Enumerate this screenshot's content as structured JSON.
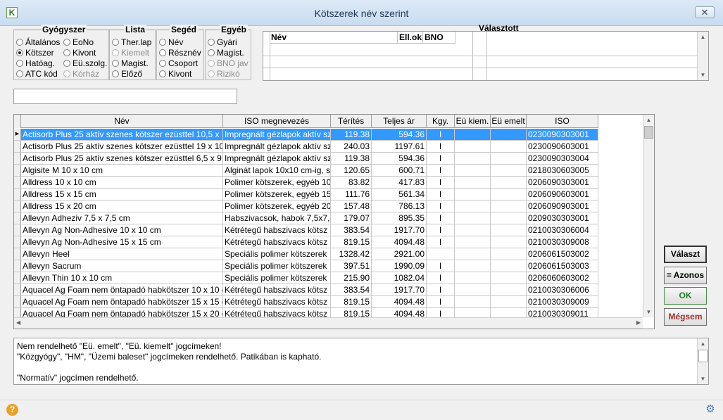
{
  "window": {
    "title": "Kötszerek név szerint",
    "close_label": "✕",
    "app_icon": "K"
  },
  "groups": {
    "gyogyszer": {
      "title": "Gyógyszer",
      "options": [
        {
          "label": "Általános",
          "checked": false,
          "disabled": false
        },
        {
          "label": "EoNo",
          "checked": false,
          "disabled": false
        },
        {
          "label": "Kötszer",
          "checked": true,
          "disabled": false
        },
        {
          "label": "Kivont",
          "checked": false,
          "disabled": false
        },
        {
          "label": "Hatóag.",
          "checked": false,
          "disabled": false
        },
        {
          "label": "Eü.szolg.",
          "checked": false,
          "disabled": false
        },
        {
          "label": "ATC kód",
          "checked": false,
          "disabled": false
        },
        {
          "label": "Kórház",
          "checked": false,
          "disabled": true
        }
      ]
    },
    "lista": {
      "title": "Lista",
      "options": [
        {
          "label": "Ther.lap",
          "checked": false,
          "disabled": false
        },
        {
          "label": "Kiemelt",
          "checked": false,
          "disabled": true
        },
        {
          "label": "Magist.",
          "checked": false,
          "disabled": false
        },
        {
          "label": "Előző",
          "checked": false,
          "disabled": false
        }
      ]
    },
    "seged": {
      "title": "Segéd",
      "options": [
        {
          "label": "Név",
          "checked": false,
          "disabled": false
        },
        {
          "label": "Résznév",
          "checked": false,
          "disabled": false
        },
        {
          "label": "Csoport",
          "checked": false,
          "disabled": false
        },
        {
          "label": "Kivont",
          "checked": false,
          "disabled": false
        }
      ]
    },
    "egyeb": {
      "title": "Egyéb",
      "options": [
        {
          "label": "Gyári",
          "checked": false,
          "disabled": false
        },
        {
          "label": "Magist.",
          "checked": false,
          "disabled": false
        },
        {
          "label": "BNO jav",
          "checked": false,
          "disabled": true
        },
        {
          "label": "Rizikó",
          "checked": false,
          "disabled": true
        }
      ]
    }
  },
  "selected": {
    "title": "Választott",
    "headers": [
      "Név",
      "Ell.ok",
      "BNO"
    ]
  },
  "search": {
    "value": ""
  },
  "grid": {
    "headers": [
      "Név",
      "ISO megnevezés",
      "Térítés",
      "Teljes ár",
      "Kgy.",
      "Eü kiem.",
      "Eü emelt",
      "ISO"
    ],
    "rows": [
      [
        "Actisorb Plus 25 aktív szenes kötszer ezüsttel 10,5 x 1",
        "Impregnált gézlapok aktív sz",
        "119.38",
        "594.36",
        "I",
        "",
        "",
        "0230090303001"
      ],
      [
        "Actisorb Plus 25 aktív szenes kötszer ezüsttel 19 x 10,",
        "Impregnált gézlapok aktív sz",
        "240.03",
        "1197.61",
        "I",
        "",
        "",
        "0230090603001"
      ],
      [
        "Actisorb Plus 25 aktív szenes kötszer ezüsttel 6,5 x 9,5",
        "Impregnált gézlapok aktív sz",
        "119.38",
        "594.36",
        "I",
        "",
        "",
        "0230090303004"
      ],
      [
        "Algisite M 10 x 10 cm",
        "Alginát lapok 10x10 cm-ig, s",
        "120.65",
        "600.71",
        "I",
        "",
        "",
        "0218030603005"
      ],
      [
        "Alldress 10 x 10 cm",
        "Polimer kötszerek, egyéb 10",
        "83.82",
        "417.83",
        "I",
        "",
        "",
        "0206090303001"
      ],
      [
        "Alldress 15 x 15 cm",
        "Polimer kötszerek, egyéb 15",
        "111.76",
        "561.34",
        "I",
        "",
        "",
        "0206090603001"
      ],
      [
        "Alldress 15 x 20 cm",
        "Polimer kötszerek, egyéb 20",
        "157.48",
        "786.13",
        "I",
        "",
        "",
        "0206090903001"
      ],
      [
        "Allevyn Adheziv 7,5 x 7,5 cm",
        "Habszivacsok, habok 7,5x7,",
        "179.07",
        "895.35",
        "I",
        "",
        "",
        "0209030303001"
      ],
      [
        "Allevyn Ag Non-Adhesive 10 x 10 cm",
        "Kétrétegű habszivacs kötsz",
        "383.54",
        "1917.70",
        "I",
        "",
        "",
        "0210030306004"
      ],
      [
        "Allevyn Ag Non-Adhesive 15 x 15 cm",
        "Kétrétegű habszivacs kötsz",
        "819.15",
        "4094.48",
        "I",
        "",
        "",
        "0210030309008"
      ],
      [
        "Allevyn Heel",
        "Speciális polimer kötszerek",
        "1328.42",
        "2921.00",
        "",
        "",
        "",
        "0206061503002"
      ],
      [
        "Allevyn Sacrum",
        "Speciális polimer kötszerek",
        "397.51",
        "1990.09",
        "I",
        "",
        "",
        "0206061503003"
      ],
      [
        "Allevyn Thin 10 x 10 cm",
        "Speciális polimer kötszerek",
        "215.90",
        "1082.04",
        "I",
        "",
        "",
        "0206060603002"
      ],
      [
        "Aquacel Ag Foam nem öntapadó habkötszer 10 x 10 cm",
        "Kétrétegű habszivacs kötsz",
        "383.54",
        "1917.70",
        "I",
        "",
        "",
        "0210030306006"
      ],
      [
        "Aquacel Ag Foam nem öntapadó habkötszer 15 x 15 cm",
        "Kétrétegű habszivacs kötsz",
        "819.15",
        "4094.48",
        "I",
        "",
        "",
        "0210030309009"
      ],
      [
        "Aquacel Ag Foam nem öntapadó habkötszer 15 x 20 cm",
        "Kétrétegű habszivacs kötsz",
        "819.15",
        "4094.48",
        "I",
        "",
        "",
        "0210030309011"
      ]
    ]
  },
  "buttons": {
    "valaszt": "Választ",
    "azonos": "= Azonos",
    "ok": "OK",
    "megsem": "Mégsem"
  },
  "info": {
    "line1": "Nem rendelhető \"Eü. emelt\", \"Eü. kiemelt\" jogcímeken!",
    "line2": "\"Közgyógy\", \"HM\", \"Üzemi baleset\" jogcímeken rendelhető. Patikában is kapható.",
    "line3": "\"Normatív\" jogcímen rendelhető."
  },
  "status": {
    "help_icon": "?",
    "gear_icon": "⚙"
  }
}
